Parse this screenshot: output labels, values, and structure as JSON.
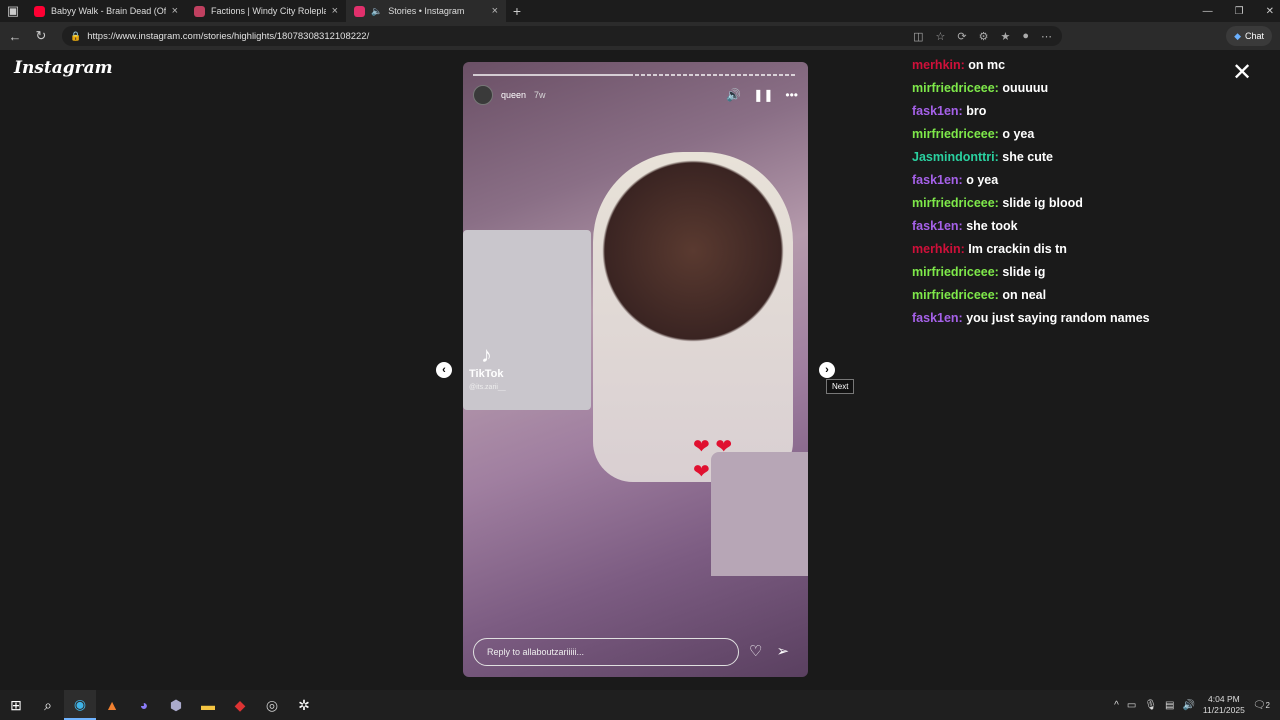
{
  "browser": {
    "tabs": [
      {
        "title": "Babyy Walk - Brain Dead (Official",
        "favicon_color": "#ff0033",
        "active": false
      },
      {
        "title": "Factions | Windy City Roleplay",
        "favicon_color": "#c04060",
        "active": false
      },
      {
        "title": "Stories • Instagram",
        "favicon_color": "#e1306c",
        "active": true
      }
    ],
    "new_tab": "+",
    "window_controls": [
      "—",
      "❐",
      "✕"
    ],
    "url": "https://www.instagram.com/stories/highlights/18078308312108222/",
    "chat_button": "Chat"
  },
  "instagram": {
    "logo": "Instagram",
    "story": {
      "progress": 0.49,
      "username": "queen",
      "time": "7w",
      "tiktok_label": "TikTok",
      "tiktok_handle": "@its.zarii__",
      "reply_placeholder": "Reply to allaboutzariiiii..."
    },
    "tooltip": "Next"
  },
  "chat": [
    {
      "user": "merhkin:",
      "text": "on mc",
      "color": "#d0103a"
    },
    {
      "user": "mirfriedriceee:",
      "text": "ouuuuu",
      "color": "#7ee84a"
    },
    {
      "user": "fask1en:",
      "text": "bro",
      "color": "#a561e8"
    },
    {
      "user": "mirfriedriceee:",
      "text": "o yea",
      "color": "#7ee84a"
    },
    {
      "user": "Jasmindonttri:",
      "text": "she cute",
      "color": "#2ad1a0"
    },
    {
      "user": "fask1en:",
      "text": "o yea",
      "color": "#a561e8"
    },
    {
      "user": "mirfriedriceee:",
      "text": "slide ig blood",
      "color": "#7ee84a"
    },
    {
      "user": "fask1en:",
      "text": "she took",
      "color": "#a561e8"
    },
    {
      "user": "merhkin:",
      "text": "Im crackin dis tn",
      "color": "#d0103a"
    },
    {
      "user": "mirfriedriceee:",
      "text": "slide ig",
      "color": "#7ee84a"
    },
    {
      "user": "mirfriedriceee:",
      "text": "on neal",
      "color": "#7ee84a"
    },
    {
      "user": "fask1en:",
      "text": "you just saying random names",
      "color": "#a561e8"
    }
  ],
  "taskbar": {
    "time": "4:04 PM",
    "date": "11/21/2025",
    "notifications": "2"
  }
}
